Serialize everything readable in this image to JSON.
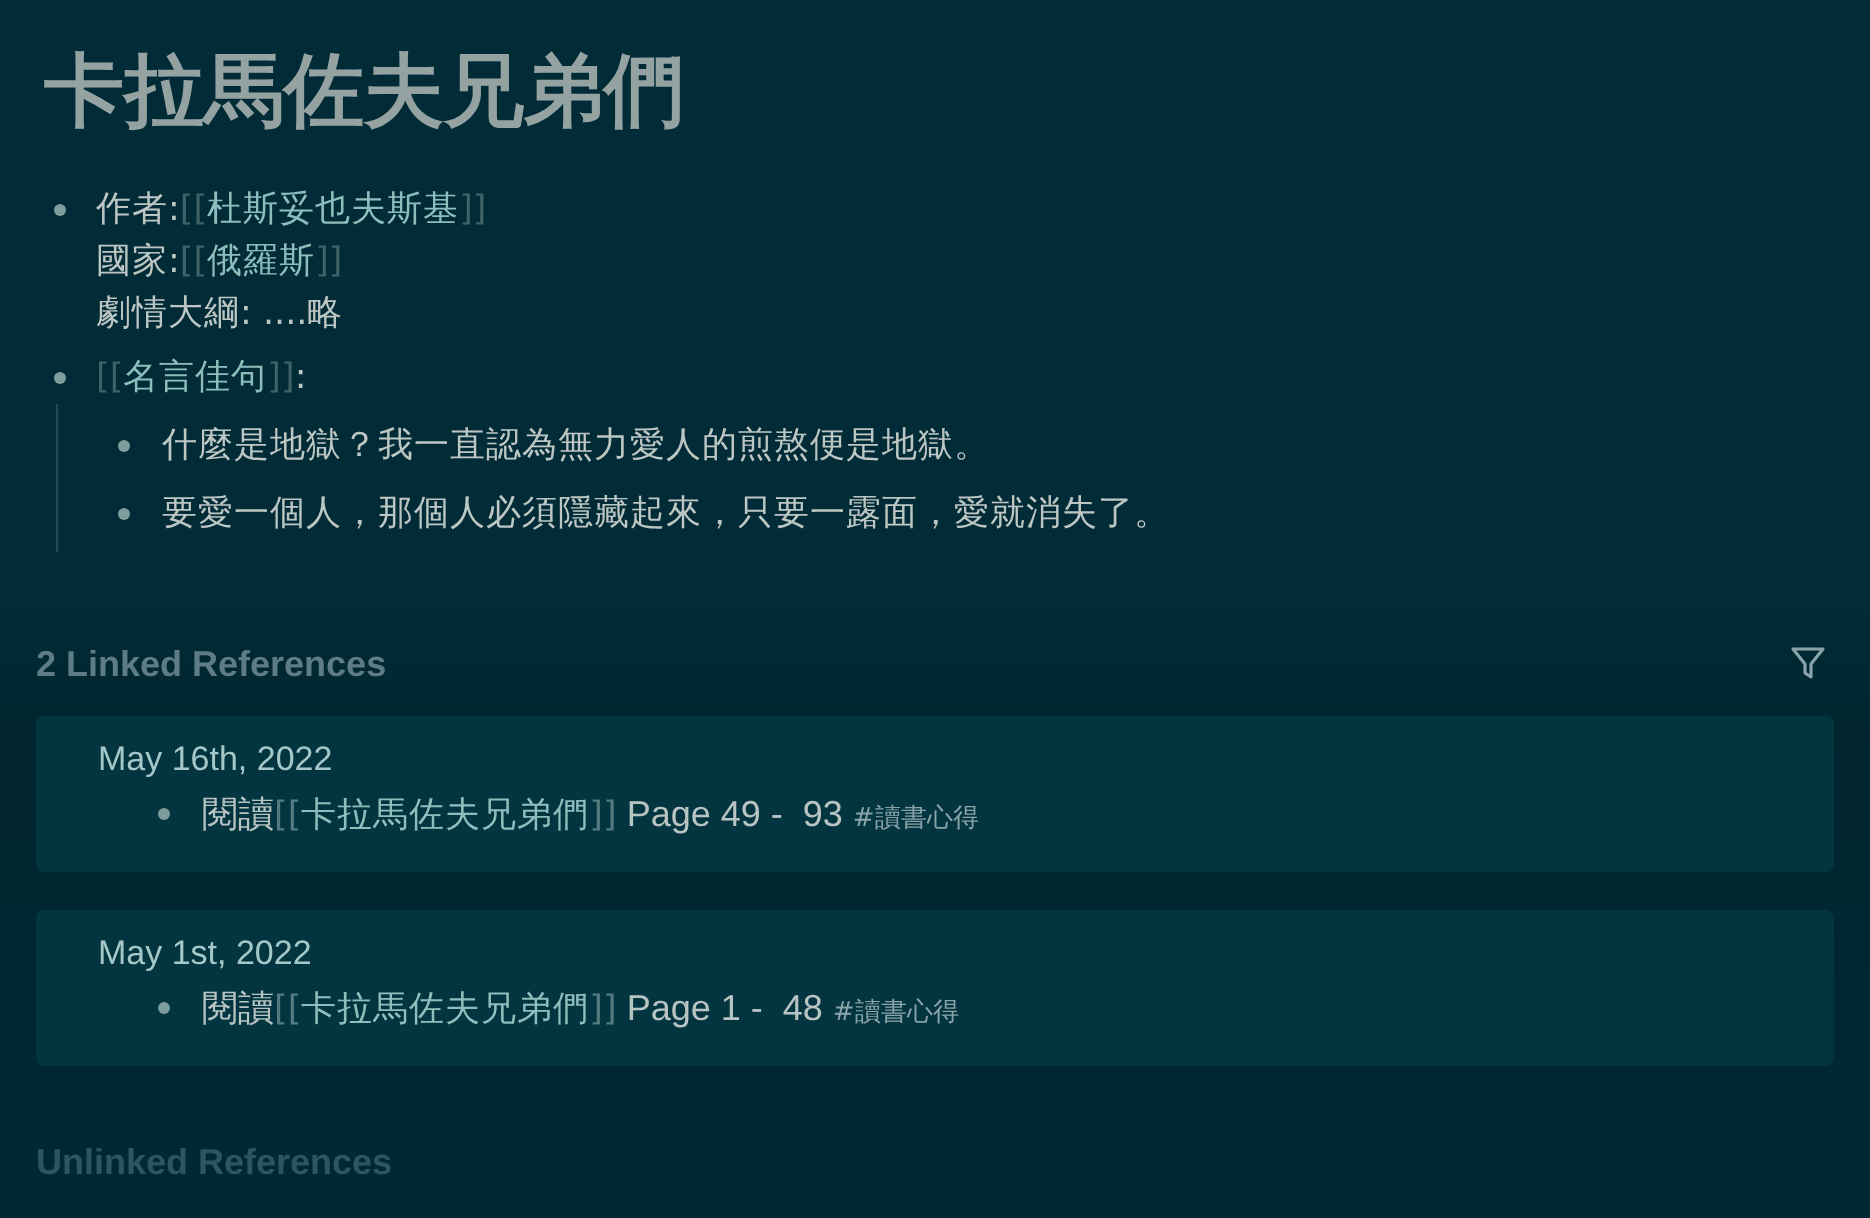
{
  "page": {
    "title": "卡拉馬佐夫兄弟們"
  },
  "blocks": [
    {
      "lines": [
        [
          {
            "kind": "text",
            "text": "作者:"
          },
          {
            "kind": "link",
            "open": "[[",
            "text": "杜斯妥也夫斯基",
            "close": "]]"
          }
        ],
        [
          {
            "kind": "text",
            "text": "國家:"
          },
          {
            "kind": "link",
            "open": "[[",
            "text": "俄羅斯",
            "close": "]]"
          }
        ],
        [
          {
            "kind": "text",
            "text": "劇情大綱: ....略"
          }
        ]
      ]
    },
    {
      "lines": [
        [
          {
            "kind": "link",
            "open": "[[",
            "text": "名言佳句",
            "close": "]]"
          },
          {
            "kind": "text",
            "text": ":"
          }
        ]
      ],
      "children": [
        {
          "lines": [
            [
              {
                "kind": "text",
                "text": "什麼是地獄？我一直認為無力愛人的煎熬便是地獄。"
              }
            ]
          ]
        },
        {
          "lines": [
            [
              {
                "kind": "text",
                "text": "要愛一個人，那個人必須隱藏起來，只要一露面，愛就消失了。"
              }
            ]
          ]
        }
      ]
    }
  ],
  "linked_references": {
    "title": "2 Linked References",
    "groups": [
      {
        "date": "May 16th, 2022",
        "blocks": [
          [
            {
              "kind": "text",
              "text": "閱讀"
            },
            {
              "kind": "link",
              "open": "[[",
              "text": "卡拉馬佐夫兄弟們",
              "close": "]]"
            },
            {
              "kind": "text",
              "text": " Page 49 -  93 "
            },
            {
              "kind": "tag",
              "text": "#讀書心得"
            }
          ]
        ]
      },
      {
        "date": "May 1st, 2022",
        "blocks": [
          [
            {
              "kind": "text",
              "text": "閱讀"
            },
            {
              "kind": "link",
              "open": "[[",
              "text": "卡拉馬佐夫兄弟們",
              "close": "]]"
            },
            {
              "kind": "text",
              "text": " Page 1 -  48 "
            },
            {
              "kind": "tag",
              "text": "#讀書心得"
            }
          ]
        ]
      }
    ]
  },
  "unlinked_references": {
    "title": "Unlinked References"
  }
}
